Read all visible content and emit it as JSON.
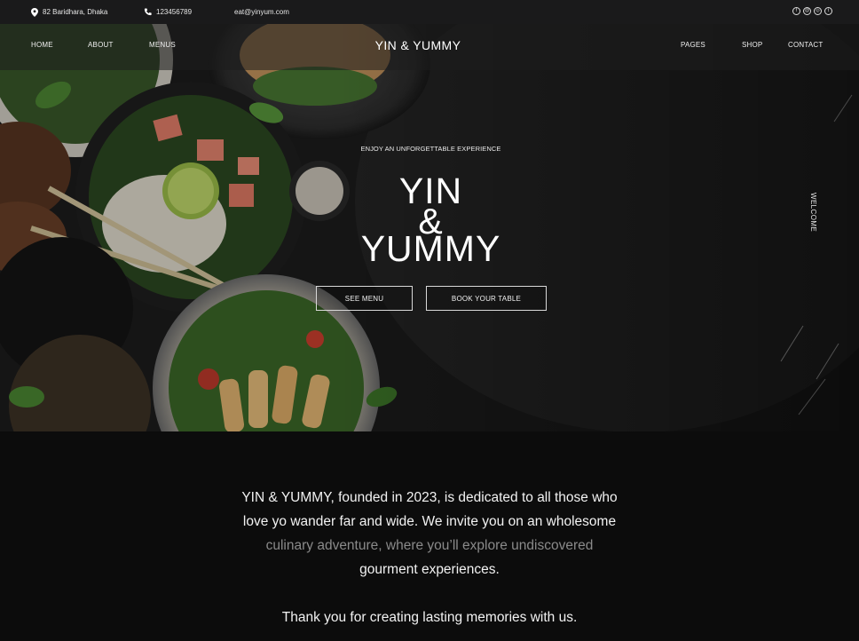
{
  "topbar": {
    "address": "82 Baridhara, Dhaka",
    "phone": "123456789",
    "email": "eat@yinyum.com",
    "social_icons": [
      "facebook-icon",
      "threads-icon",
      "instagram-icon",
      "twitter-icon"
    ]
  },
  "nav": {
    "left": [
      "HOME",
      "ABOUT",
      "MENUS"
    ],
    "brand": "YIN & YUMMY",
    "right": [
      "PAGES",
      "SHOP",
      "CONTACT"
    ]
  },
  "hero": {
    "kicker": "ENJOY AN UNFORGETTABLE EXPERIENCE",
    "title_line1": "YIN",
    "title_line2": "&",
    "title_line3": "YUMMY",
    "see_menu": "SEE MENU",
    "book_table": "BOOK YOUR TABLE",
    "side_label": "WELCOME"
  },
  "intro": {
    "line1": "YIN & YUMMY, founded in 2023, is dedicated to all those who",
    "line2": "love yo wander far and wide. We invite you on an wholesome",
    "line3": "culinary adventure, where you’ll explore undiscovered",
    "line4": "gourment experiences.",
    "line5": "Thank you for creating lasting memories with us."
  },
  "colors": {
    "background": "#0c0c0c",
    "topbar": "#1a1a1b",
    "text": "#ffffff",
    "muted_text": "#8a8a8a"
  }
}
